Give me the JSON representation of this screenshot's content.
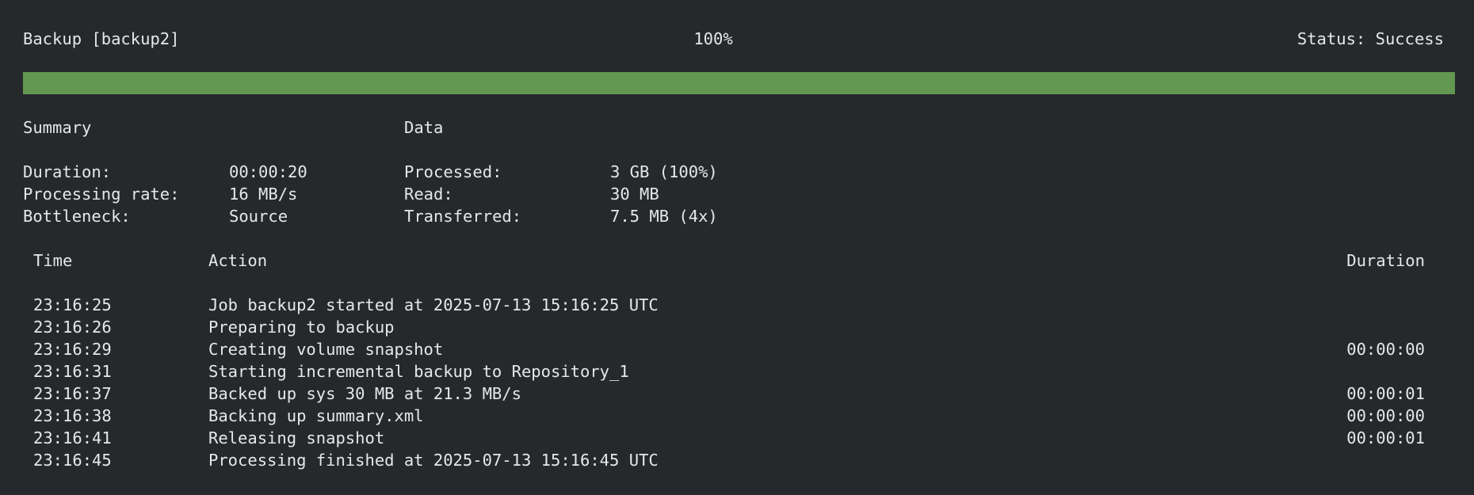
{
  "header": {
    "title": "Backup [backup2]",
    "percent": "100%",
    "status": "Status: Success",
    "progress": 1.0,
    "progress_color": "#629852"
  },
  "summary": {
    "heading": "Summary",
    "rows": [
      {
        "label": "Duration:",
        "value": "00:00:20"
      },
      {
        "label": "Processing rate:",
        "value": "16 MB/s"
      },
      {
        "label": "Bottleneck:",
        "value": "Source"
      }
    ]
  },
  "data": {
    "heading": "Data",
    "rows": [
      {
        "label": "Processed:",
        "value": "3 GB (100%)"
      },
      {
        "label": "Read:",
        "value": "30 MB"
      },
      {
        "label": "Transferred:",
        "value": "7.5 MB (4x)"
      }
    ]
  },
  "log": {
    "columns": {
      "time": "Time",
      "action": "Action",
      "duration": "Duration"
    },
    "rows": [
      {
        "time": "23:16:25",
        "action": "Job backup2 started at 2025-07-13 15:16:25 UTC",
        "duration": ""
      },
      {
        "time": "23:16:26",
        "action": "Preparing to backup",
        "duration": ""
      },
      {
        "time": "23:16:29",
        "action": "Creating volume snapshot",
        "duration": "00:00:00"
      },
      {
        "time": "23:16:31",
        "action": "Starting incremental backup to Repository_1",
        "duration": ""
      },
      {
        "time": "23:16:37",
        "action": "Backed up sys 30 MB at 21.3 MB/s",
        "duration": "00:00:01"
      },
      {
        "time": "23:16:38",
        "action": "Backing up summary.xml",
        "duration": "00:00:00"
      },
      {
        "time": "23:16:41",
        "action": "Releasing snapshot",
        "duration": "00:00:01"
      },
      {
        "time": "23:16:45",
        "action": "Processing finished at 2025-07-13 15:16:45 UTC",
        "duration": ""
      }
    ]
  }
}
